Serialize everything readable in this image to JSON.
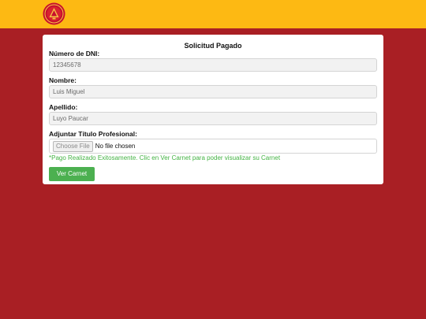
{
  "header": {
    "logo_icon": "institution-seal-icon"
  },
  "form": {
    "title": "Solicitud Pagado",
    "dni_label": "Número de DNI:",
    "dni_value": "12345678",
    "nombre_label": "Nombre:",
    "nombre_value": "Luis Miguel",
    "apellido_label": "Apellido:",
    "apellido_value": "Luyo Paucar",
    "adjuntar_label": "Adjuntar Título Profesional:",
    "file_button": "Choose File",
    "file_status": "No file chosen",
    "success_message": "*Pago Realizado Exitosamente. Clic en Ver Carnet para poder visualizar su Carnet",
    "submit_label": "Ver Carnet"
  },
  "colors": {
    "background": "#a91f24",
    "topbar": "#fdb913",
    "success": "#43b343",
    "button": "#4cb050"
  }
}
